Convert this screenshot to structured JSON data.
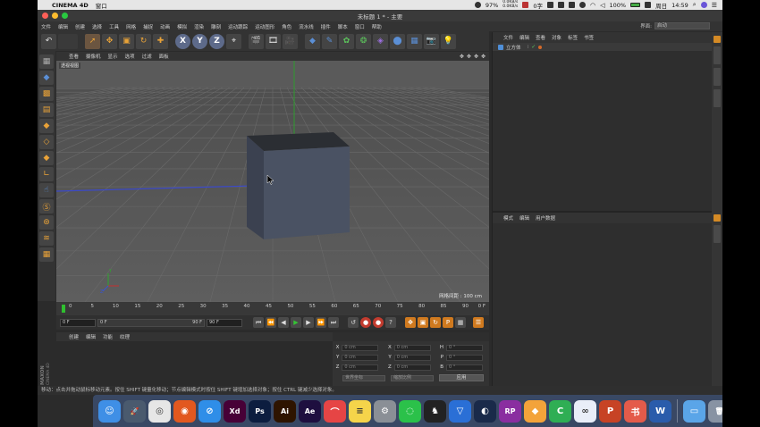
{
  "macos": {
    "app_name": "CINEMA 4D",
    "menu": [
      "窗口"
    ],
    "battery": "97%",
    "net_up": "0.0KB/s",
    "net_down": "0.0KB/s",
    "ime": "0字",
    "battery2": "100%",
    "day": "周日",
    "clock": "14:59"
  },
  "window": {
    "title": "未标题 1 * - 主要"
  },
  "c4d_menu": [
    "文件",
    "编辑",
    "创建",
    "选择",
    "工具",
    "网格",
    "捕捉",
    "动画",
    "模拟",
    "渲染",
    "雕刻",
    "运动跟踪",
    "运动图形",
    "角色",
    "流水线",
    "插件",
    "脚本",
    "窗口",
    "帮助"
  ],
  "layout": {
    "label": "界面:",
    "value": "启动"
  },
  "toolbar_axes": [
    "X",
    "Y",
    "Z"
  ],
  "viewport": {
    "menu": [
      "查看",
      "摄像机",
      "显示",
      "选项",
      "过滤",
      "面板"
    ],
    "label": "透视视图",
    "grid_distance": "网格间距 : 100 cm"
  },
  "timeline": {
    "ticks": [
      "0",
      "5",
      "10",
      "15",
      "20",
      "25",
      "30",
      "35",
      "40",
      "45",
      "50",
      "55",
      "60",
      "65",
      "70",
      "75",
      "80",
      "85",
      "90"
    ],
    "current_frame": "0 F",
    "start_field": "0 F",
    "range_start": "0 F",
    "range_end": "90 F",
    "end_field": "90 F"
  },
  "material": {
    "menu": [
      "创建",
      "编辑",
      "功能",
      "纹理"
    ]
  },
  "coordinates": {
    "header": "",
    "rows": [
      {
        "a": "X",
        "av": "0 cm",
        "b": "X",
        "bv": "0 cm",
        "c": "H",
        "cv": "0 °"
      },
      {
        "a": "Y",
        "av": "0 cm",
        "b": "Y",
        "bv": "0 cm",
        "c": "P",
        "cv": "0 °"
      },
      {
        "a": "Z",
        "av": "0 cm",
        "b": "Z",
        "bv": "0 cm",
        "c": "B",
        "cv": "0 °"
      }
    ],
    "mode1": "世界坐标",
    "mode2": "缩放比例",
    "apply": "应用"
  },
  "status": "移动：点击并拖动鼠标移动元素。按住 SHIFT 键量化移动；节点编辑模式时按住 SHIFT 键增加选择对象；按住 CTRL 键减少选择对象。",
  "object_manager": {
    "menu": [
      "文件",
      "编辑",
      "查看",
      "对象",
      "标签",
      "书签"
    ],
    "item": "立方体"
  },
  "attribute_manager": {
    "menu": [
      "模式",
      "编辑",
      "用户数据"
    ]
  },
  "branding": "MAXON CINEMA 4D",
  "dock": [
    {
      "name": "finder-icon",
      "glyph": "☺",
      "bg": "#3f8fe6"
    },
    {
      "name": "launchpad-icon",
      "glyph": "🚀",
      "bg": "#4a5a6e"
    },
    {
      "name": "chrome-icon",
      "glyph": "◎",
      "bg": "#e6e6e6"
    },
    {
      "name": "firefox-icon",
      "glyph": "◉",
      "bg": "#e2581f"
    },
    {
      "name": "safari-icon",
      "glyph": "⊘",
      "bg": "#2f8ee8"
    },
    {
      "name": "xd-icon",
      "glyph": "Xd",
      "bg": "#470137"
    },
    {
      "name": "photoshop-icon",
      "glyph": "Ps",
      "bg": "#0c1d3f"
    },
    {
      "name": "illustrator-icon",
      "glyph": "Ai",
      "bg": "#2e1400"
    },
    {
      "name": "aftereffects-icon",
      "glyph": "Ae",
      "bg": "#1e0f3f"
    },
    {
      "name": "chat-icon",
      "glyph": "⌒",
      "bg": "#e64545"
    },
    {
      "name": "notes-icon",
      "glyph": "≡",
      "bg": "#f5d44a"
    },
    {
      "name": "system-preferences-icon",
      "glyph": "⚙",
      "bg": "#8a8f96"
    },
    {
      "name": "wechat-icon",
      "glyph": "◌",
      "bg": "#2bc14a"
    },
    {
      "name": "qq-icon",
      "glyph": "♞",
      "bg": "#222"
    },
    {
      "name": "shield-icon",
      "glyph": "▽",
      "bg": "#2a6fd6"
    },
    {
      "name": "cinema4d-icon",
      "glyph": "◐",
      "bg": "#1a2a4a"
    },
    {
      "name": "axure-icon",
      "glyph": "RP",
      "bg": "#8a2ea0"
    },
    {
      "name": "sketch-icon",
      "glyph": "◆",
      "bg": "#f3a33a"
    },
    {
      "name": "c-app-icon",
      "glyph": "C",
      "bg": "#2fae54"
    },
    {
      "name": "baidu-cloud-icon",
      "glyph": "∞",
      "bg": "#e9eef8"
    },
    {
      "name": "powerpoint-icon",
      "glyph": "P",
      "bg": "#c74325"
    },
    {
      "name": "calendar-icon",
      "glyph": "书",
      "bg": "#e45b4a"
    },
    {
      "name": "word-icon",
      "glyph": "W",
      "bg": "#2a5cab"
    },
    {
      "name": "downloads-folder-icon",
      "glyph": "▭",
      "bg": "#5aa5e8"
    },
    {
      "name": "trash-icon",
      "glyph": "🗑",
      "bg": "#8893a3"
    }
  ]
}
